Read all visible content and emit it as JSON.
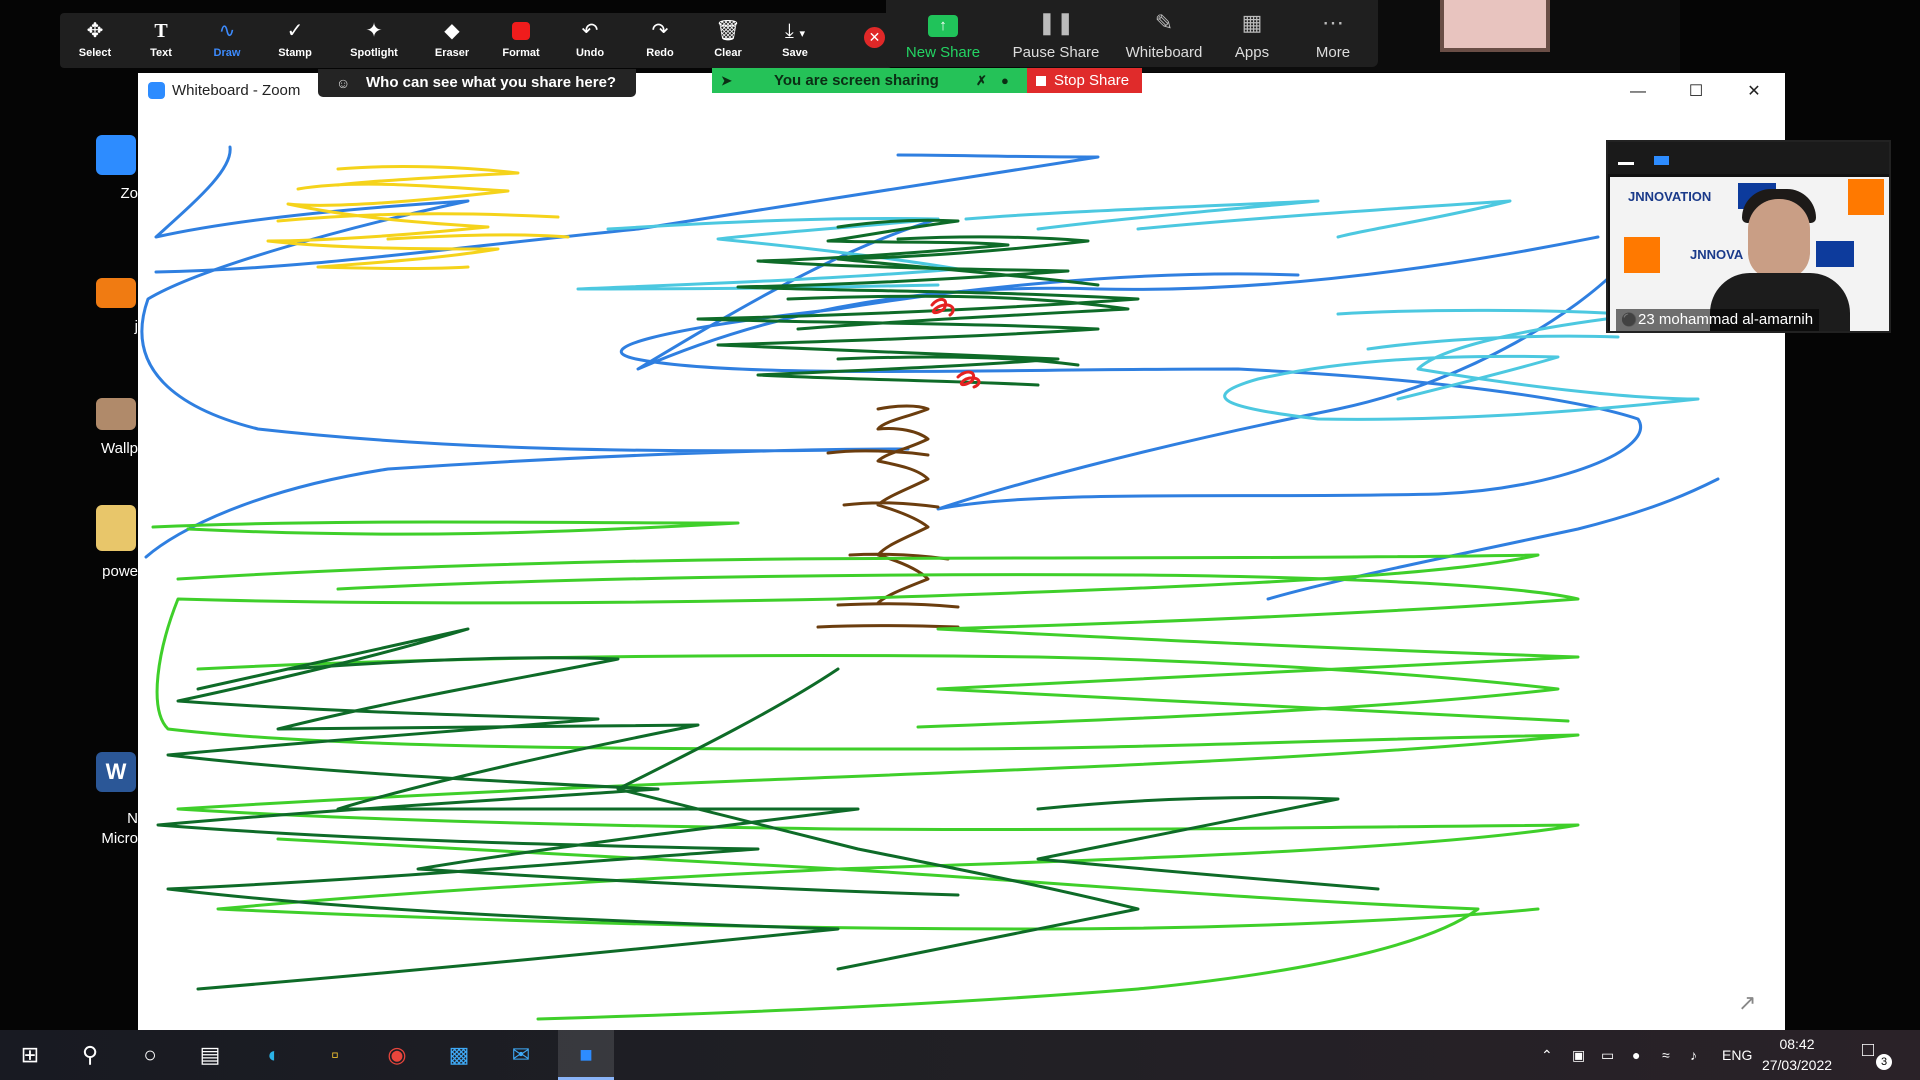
{
  "window": {
    "title": "Whiteboard - Zoom"
  },
  "annotation_toolbar": {
    "tools": [
      {
        "label": "Select",
        "icon": "move-icon"
      },
      {
        "label": "Text",
        "icon": "text-icon"
      },
      {
        "label": "Draw",
        "icon": "draw-icon",
        "active": true
      },
      {
        "label": "Stamp",
        "icon": "checkmark-icon"
      },
      {
        "label": "Spotlight",
        "icon": "spotlight-icon"
      },
      {
        "label": "Eraser",
        "icon": "eraser-icon"
      },
      {
        "label": "Format",
        "icon": "format-icon"
      },
      {
        "label": "Undo",
        "icon": "undo-icon"
      },
      {
        "label": "Redo",
        "icon": "redo-icon"
      },
      {
        "label": "Clear",
        "icon": "trash-icon"
      },
      {
        "label": "Save",
        "icon": "save-icon"
      }
    ],
    "format_color": "#f01c1c"
  },
  "share_toolbar": {
    "new_share": "New Share",
    "pause_share": "Pause Share",
    "whiteboard": "Whiteboard",
    "apps": "Apps",
    "more": "More"
  },
  "who_banner": "Who can see what you share here?",
  "sharing_bar": {
    "status": "You are screen sharing",
    "stop": "Stop Share"
  },
  "participant": {
    "name": "23 mohammad al-amarnih"
  },
  "desktop_icons": [
    {
      "label": "Zo",
      "color": "#2d8cff"
    },
    {
      "label": "j",
      "color": "#f07b12"
    },
    {
      "label": "Wallp",
      "color": "#b08a6a"
    },
    {
      "label": "powe",
      "color": "#e8c66a"
    },
    {
      "label": "N",
      "sublabel": "Micro",
      "color": "#2b5797"
    }
  ],
  "taskbar": {
    "language": "ENG",
    "time": "08:42",
    "date": "27/03/2022",
    "notifications": "3"
  },
  "colors": {
    "accent": "#2d8cff",
    "stroke_blue": "#2f7fe0",
    "stroke_cyan": "#4cc8e0",
    "stroke_yellow": "#f5d31b",
    "stroke_dark_green": "#0e6b28",
    "stroke_light_green": "#3fcf2a",
    "stroke_brown": "#6b3d0e",
    "stroke_red": "#e52222"
  }
}
